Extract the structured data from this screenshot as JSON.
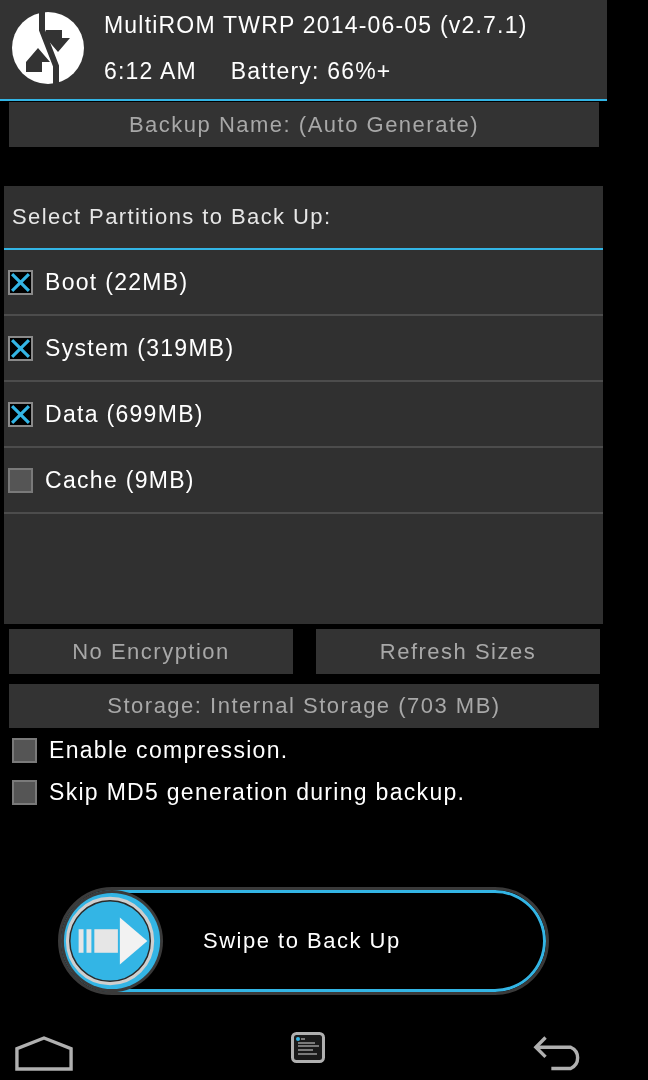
{
  "header": {
    "title": "MultiROM TWRP 2014-06-05 (v2.7.1)",
    "time": "6:12 AM",
    "battery": "Battery: 66%+"
  },
  "backup_name": {
    "label": "Backup Name: (Auto Generate)"
  },
  "partitions": {
    "title": "Select Partitions to Back Up:",
    "items": [
      {
        "label": "Boot (22MB)",
        "checked": true
      },
      {
        "label": "System (319MB)",
        "checked": true
      },
      {
        "label": "Data (699MB)",
        "checked": true
      },
      {
        "label": "Cache (9MB)",
        "checked": false
      }
    ]
  },
  "buttons": [
    {
      "label": "No Encryption"
    },
    {
      "label": "Refresh Sizes"
    }
  ],
  "storage": {
    "label": "Storage: Internal Storage (703 MB)"
  },
  "options": [
    {
      "label": "Enable compression.",
      "checked": false
    },
    {
      "label": "Skip MD5 generation during backup.",
      "checked": false
    }
  ],
  "swipe": {
    "label": "Swipe to Back Up"
  }
}
